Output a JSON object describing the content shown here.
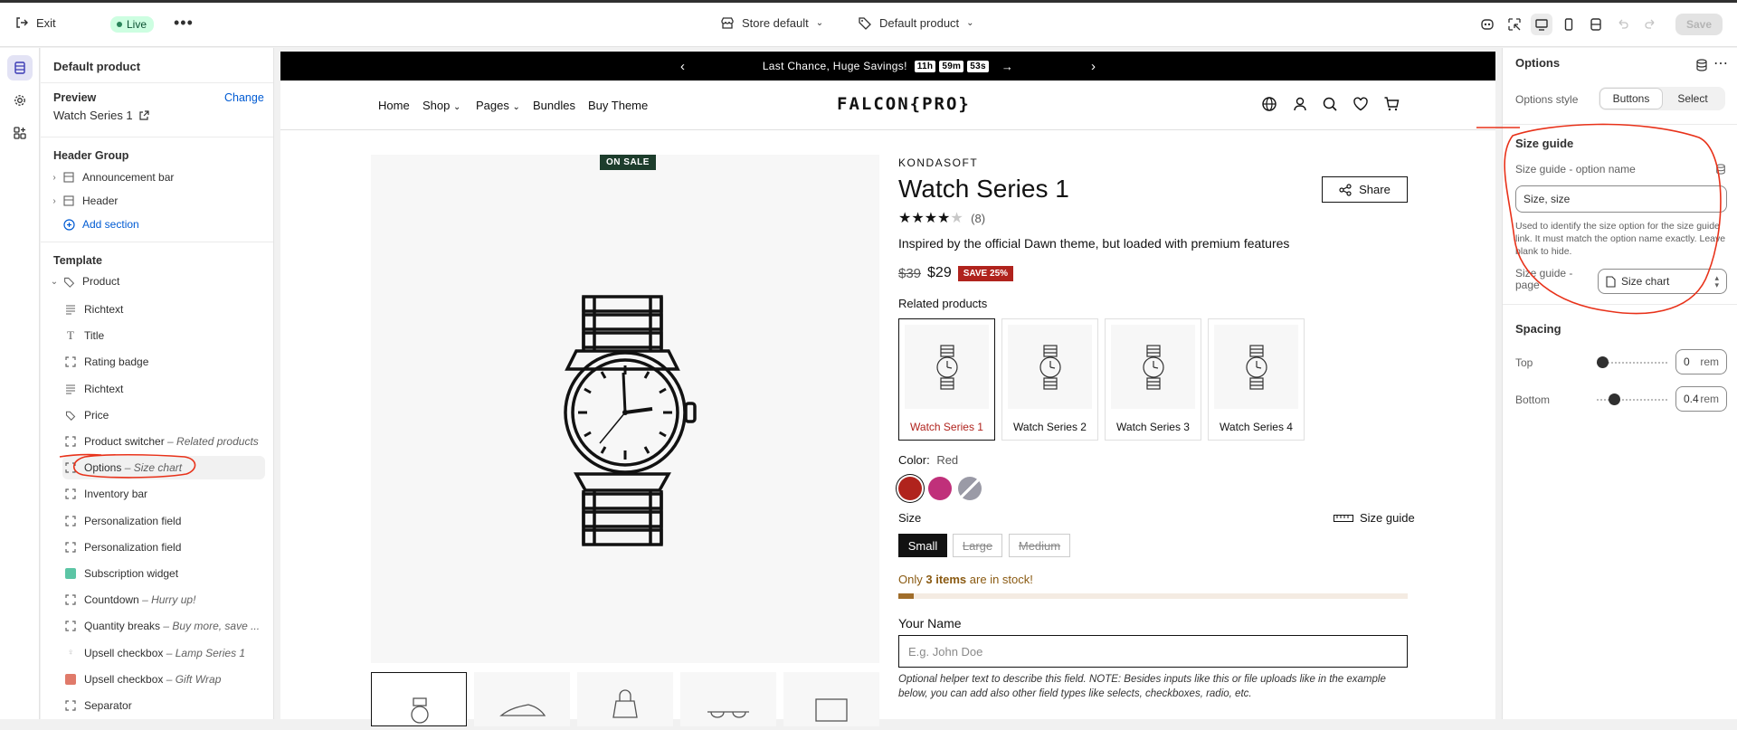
{
  "topbar": {
    "exit_label": "Exit",
    "live_label": "Live",
    "more_label": "•••",
    "store_select": "Store default",
    "template_select": "Default product",
    "save_label": "Save"
  },
  "sidebar": {
    "title": "Default product",
    "preview_label": "Preview",
    "change_label": "Change",
    "preview_value": "Watch Series 1",
    "header_group_label": "Header Group",
    "header_items": [
      {
        "label": "Announcement bar"
      },
      {
        "label": "Header"
      }
    ],
    "add_section_label": "Add section",
    "template_label": "Template",
    "product_label": "Product",
    "blocks": [
      {
        "label": "Richtext",
        "sub": ""
      },
      {
        "label": "Title",
        "sub": ""
      },
      {
        "label": "Rating badge",
        "sub": ""
      },
      {
        "label": "Richtext",
        "sub": ""
      },
      {
        "label": "Price",
        "sub": ""
      },
      {
        "label": "Product switcher",
        "sub": "– Related products"
      },
      {
        "label": "Options",
        "sub": "– Size chart"
      },
      {
        "label": "Inventory bar",
        "sub": ""
      },
      {
        "label": "Personalization field",
        "sub": ""
      },
      {
        "label": "Personalization field",
        "sub": ""
      },
      {
        "label": "Subscription widget",
        "sub": ""
      },
      {
        "label": "Countdown",
        "sub": "– Hurry up!"
      },
      {
        "label": "Quantity breaks",
        "sub": "– Buy more, save ..."
      },
      {
        "label": "Upsell checkbox",
        "sub": "– Lamp Series 1"
      },
      {
        "label": "Upsell checkbox",
        "sub": "– Gift Wrap"
      },
      {
        "label": "Separator",
        "sub": ""
      }
    ]
  },
  "store": {
    "announcement": "Last Chance, Huge Savings!",
    "timer_h": "11h",
    "timer_m": "59m",
    "timer_s": "53s",
    "nav": [
      "Home",
      "Shop",
      "Pages",
      "Bundles",
      "Buy Theme"
    ],
    "logo": "FALCON{PRO}",
    "badge": "ON SALE",
    "vendor": "KONDASOFT",
    "title": "Watch Series 1",
    "stars": "★★★★★",
    "review_count": "(8)",
    "rating": 4,
    "description": "Inspired by the official Dawn theme, but loaded with premium features",
    "compare_price": "$39",
    "price": "$29",
    "save_badge": "SAVE 25%",
    "share_label": "Share",
    "related_label": "Related products",
    "related": [
      "Watch Series 1",
      "Watch Series 2",
      "Watch Series 3",
      "Watch Series 4"
    ],
    "color_label": "Color:",
    "color_value": "Red",
    "swatch_colors": [
      "#b0231d",
      "#c0307a",
      "#9a9aa6"
    ],
    "size_label": "Size",
    "size_guide_label": "Size guide",
    "sizes": [
      "Small",
      "Large",
      "Medium"
    ],
    "stock_prefix": "Only",
    "stock_count": "3 items",
    "stock_suffix": "are in stock!",
    "stock_fill": 0.03,
    "name_label": "Your Name",
    "name_placeholder": "E.g. John Doe",
    "helper_text": "Optional helper text to describe this field. NOTE: Besides inputs like this or file uploads like in the example below, you can add also other field types like selects, checkboxes, radio, etc."
  },
  "options_panel": {
    "title": "Options",
    "style_label": "Options style",
    "style_buttons": "Buttons",
    "style_select": "Select",
    "size_guide_heading": "Size guide",
    "option_name_label": "Size guide - option name",
    "option_name_value": "Size, size",
    "help_text": "Used to identify the size option for the size guide link. It must match the option name exactly. Leave blank to hide.",
    "page_label": "Size guide - page",
    "page_value": "Size chart",
    "spacing_heading": "Spacing",
    "top_label": "Top",
    "top_value": "0",
    "bottom_label": "Bottom",
    "bottom_value": "0.4",
    "unit": "rem",
    "top_fraction": 0.0,
    "bottom_fraction": 0.2
  },
  "colors": {
    "accent": "#b0231d",
    "annotation": "#e8321a",
    "stock": "#8a5a12"
  }
}
